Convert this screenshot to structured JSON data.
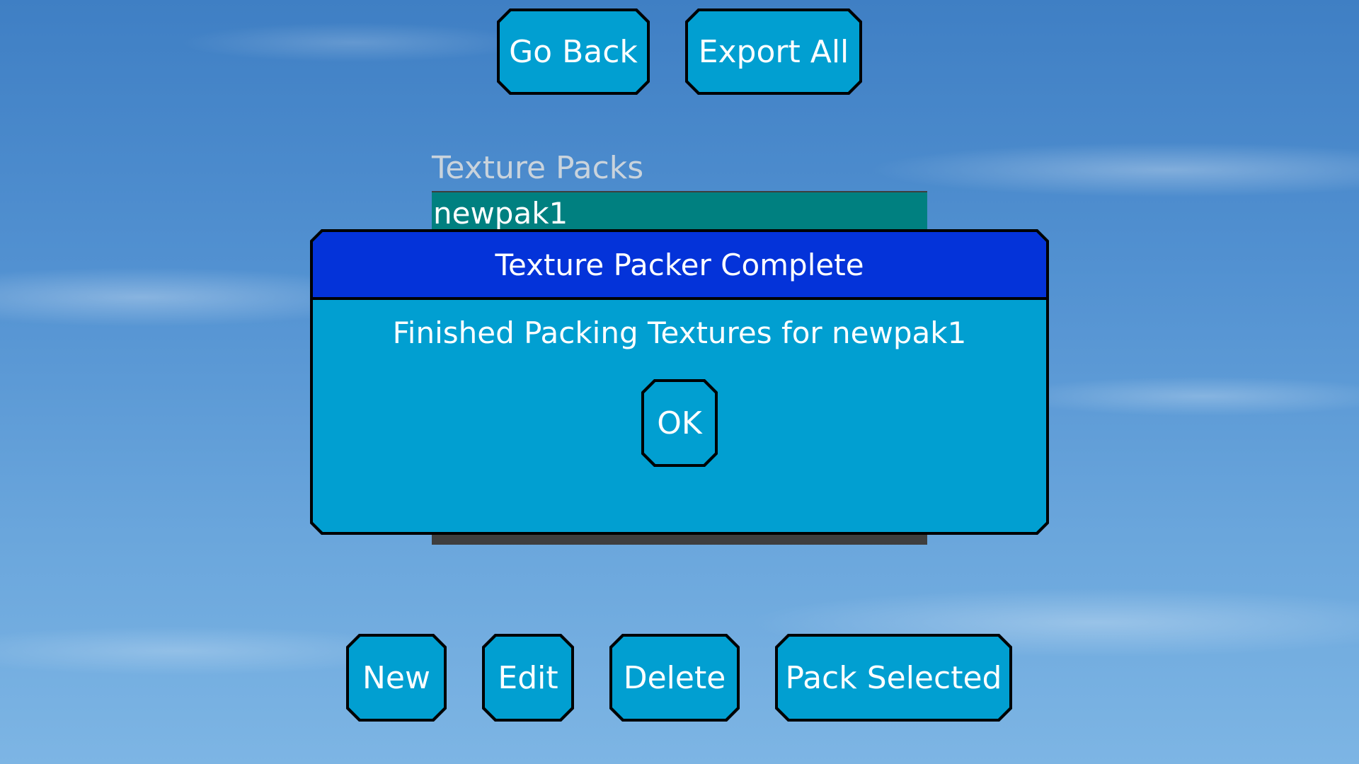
{
  "toolbar_top": {
    "go_back_label": "Go Back",
    "export_all_label": "Export All"
  },
  "texture_packs": {
    "label": "Texture Packs",
    "items": [
      "newpak1"
    ]
  },
  "dialog": {
    "title": "Texture Packer Complete",
    "message": "Finished Packing Textures for newpak1",
    "ok_label": "OK"
  },
  "toolbar_bottom": {
    "new_label": "New",
    "edit_label": "Edit",
    "delete_label": "Delete",
    "pack_selected_label": "Pack Selected"
  },
  "colors": {
    "button_fill": "#019fd1",
    "dialog_title_bar": "#0433d9",
    "selected_row": "#008080",
    "list_background": "#3e3e3e"
  }
}
